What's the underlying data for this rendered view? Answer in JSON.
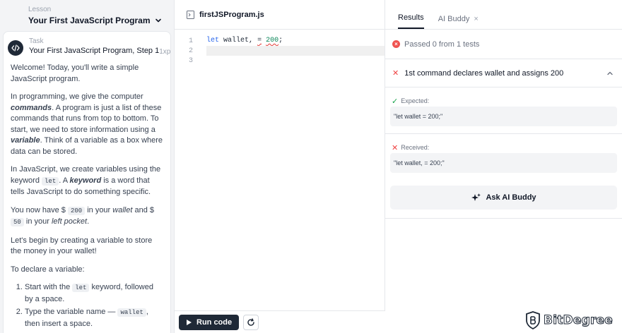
{
  "lesson": {
    "label": "Lesson",
    "title": "Your First JavaScript Program"
  },
  "task": {
    "label": "Task",
    "title": "Your First JavaScript Program, Step 1",
    "xp": "1xp",
    "paragraphs": {
      "p1": "Welcome! Today, you'll write a simple JavaScript program.",
      "p2a": "In programming, we give the computer ",
      "p2b": "commands",
      "p2c": ". A program is just a list of these commands that runs from top to bottom. To start, we need to store information using a ",
      "p2d": "variable",
      "p2e": ". Think of a variable as a box where data can be stored.",
      "p3a": "In JavaScript, we create variables using the keyword ",
      "p3b": "let",
      "p3c": ". A ",
      "p3d": "keyword",
      "p3e": " is a word that tells JavaScript to do something specific.",
      "p4a": "You now have $ ",
      "p4b": "200",
      "p4c": " in your ",
      "p4d": "wallet",
      "p4e": " and $ ",
      "p4f": "50",
      "p4g": " in your ",
      "p4h": "left pocket",
      "p4i": ".",
      "p5": "Let's begin by creating a variable to store the money in your wallet!",
      "p6": "To declare a variable:"
    },
    "steps": {
      "s1a": "Start with the ",
      "s1b": "let",
      "s1c": " keyword, followed by a space.",
      "s2a": "Type the variable name — ",
      "s2b": "wallet",
      "s2c": ", then insert a space."
    }
  },
  "editor": {
    "file_name": "firstJSProgram.js",
    "line_numbers": [
      "1",
      "2",
      "3"
    ],
    "code": {
      "kw": "let",
      "name": " wallet",
      "comma": ",",
      "space": " ",
      "eq": "=",
      "space2": " ",
      "value": "200",
      "semi": ";"
    },
    "run_label": "Run code"
  },
  "results": {
    "tabs": {
      "results": "Results",
      "ai_buddy": "AI Buddy",
      "close": "×"
    },
    "status": "Passed 0 from 1 tests",
    "test_title": "1st command declares wallet and assigns 200",
    "expected_label": "Expected:",
    "expected_value": "\"let wallet = 200;\"",
    "received_label": "Received:",
    "received_value": "\"let wallet, = 200;\"",
    "ai_button": "Ask AI Buddy"
  },
  "watermark": {
    "text": "BitDegree"
  },
  "colors": {
    "dark": "#1f2937",
    "error": "#ef5350",
    "success": "#16a34a",
    "panel_bg": "#f3f4f6"
  }
}
